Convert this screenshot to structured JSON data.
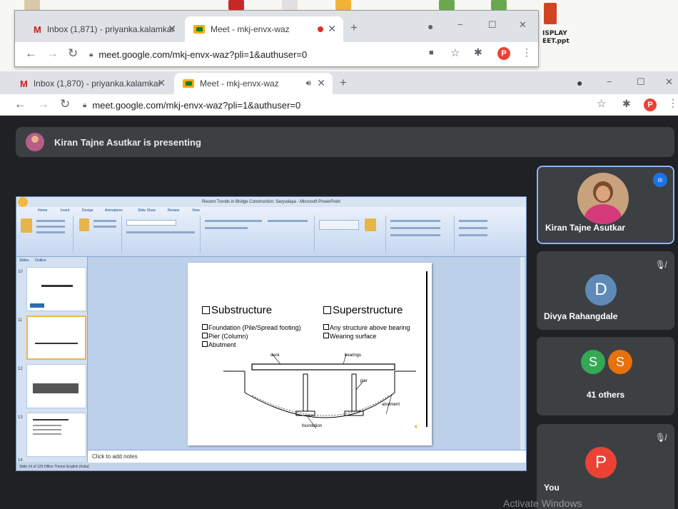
{
  "desktop": {
    "labels": [
      "ISPLAY",
      "EET.ppt"
    ]
  },
  "back_window": {
    "tabs": [
      {
        "label": "Inbox (1,871) - priyanka.kalamkar",
        "icon": "gmail-icon"
      },
      {
        "label": "Meet - mkj-envx-waz",
        "icon": "meet-icon"
      }
    ],
    "new_tab": "+",
    "url": "meet.google.com/mkj-envx-waz?pli=1&authuser=0",
    "profile": "P",
    "controls": [
      "−",
      "☐",
      "✕"
    ]
  },
  "front_window": {
    "tabs": [
      {
        "label": "Inbox (1,870) - priyanka.kalamkar",
        "icon": "gmail-icon"
      },
      {
        "label": "Meet - mkj-envx-waz",
        "icon": "meet-icon"
      }
    ],
    "new_tab": "+",
    "url": "meet.google.com/mkj-envx-waz?pli=1&authuser=0",
    "profile": "P",
    "controls": [
      "−",
      "☐",
      "✕"
    ]
  },
  "meet": {
    "presenting_text": "Kiran Tajne Asutkar is presenting",
    "watermark": "Activate Windows"
  },
  "powerpoint": {
    "title": "Recent Trends in Bridge Construction: Saryudaya - Microsoft PowerPoint",
    "ribbon_tabs": [
      "Home",
      "Insert",
      "Design",
      "Animations",
      "Slide Show",
      "Review",
      "View"
    ],
    "pane_tabs": [
      "Slides",
      "Outline"
    ],
    "notes_placeholder": "Click to add notes",
    "status_text": "Slide 14 of 125    Office Theme    English (India)",
    "slide": {
      "left_heading": "Substructure",
      "right_heading": "Superstructure",
      "left_items": [
        "Foundation (Pile/Spread footing)",
        "Pier (Column)",
        "Abutment"
      ],
      "right_items": [
        "Any structure above bearing",
        "Wearing surface"
      ],
      "diagram_labels": [
        "deck",
        "bearings",
        "pier",
        "abutment",
        "foundation"
      ]
    },
    "thumb_numbers": [
      "10",
      "11",
      "12",
      "13",
      "14"
    ]
  },
  "participants": [
    {
      "name": "Kiran Tajne Asutkar",
      "initial": "",
      "avatar_color": "#c7a27c",
      "muted": false,
      "speaking": true
    },
    {
      "name": "Divya Rahangdale",
      "initial": "D",
      "avatar_color": "#5f8ab8",
      "muted": true,
      "speaking": false
    },
    {
      "name": "41 others",
      "initials": [
        "S",
        "S"
      ],
      "avatar_colors": [
        "#34a853",
        "#e8710a"
      ],
      "muted": false,
      "speaking": false
    },
    {
      "name": "You",
      "initial": "P",
      "avatar_color": "#ea4335",
      "muted": true,
      "speaking": false
    }
  ]
}
